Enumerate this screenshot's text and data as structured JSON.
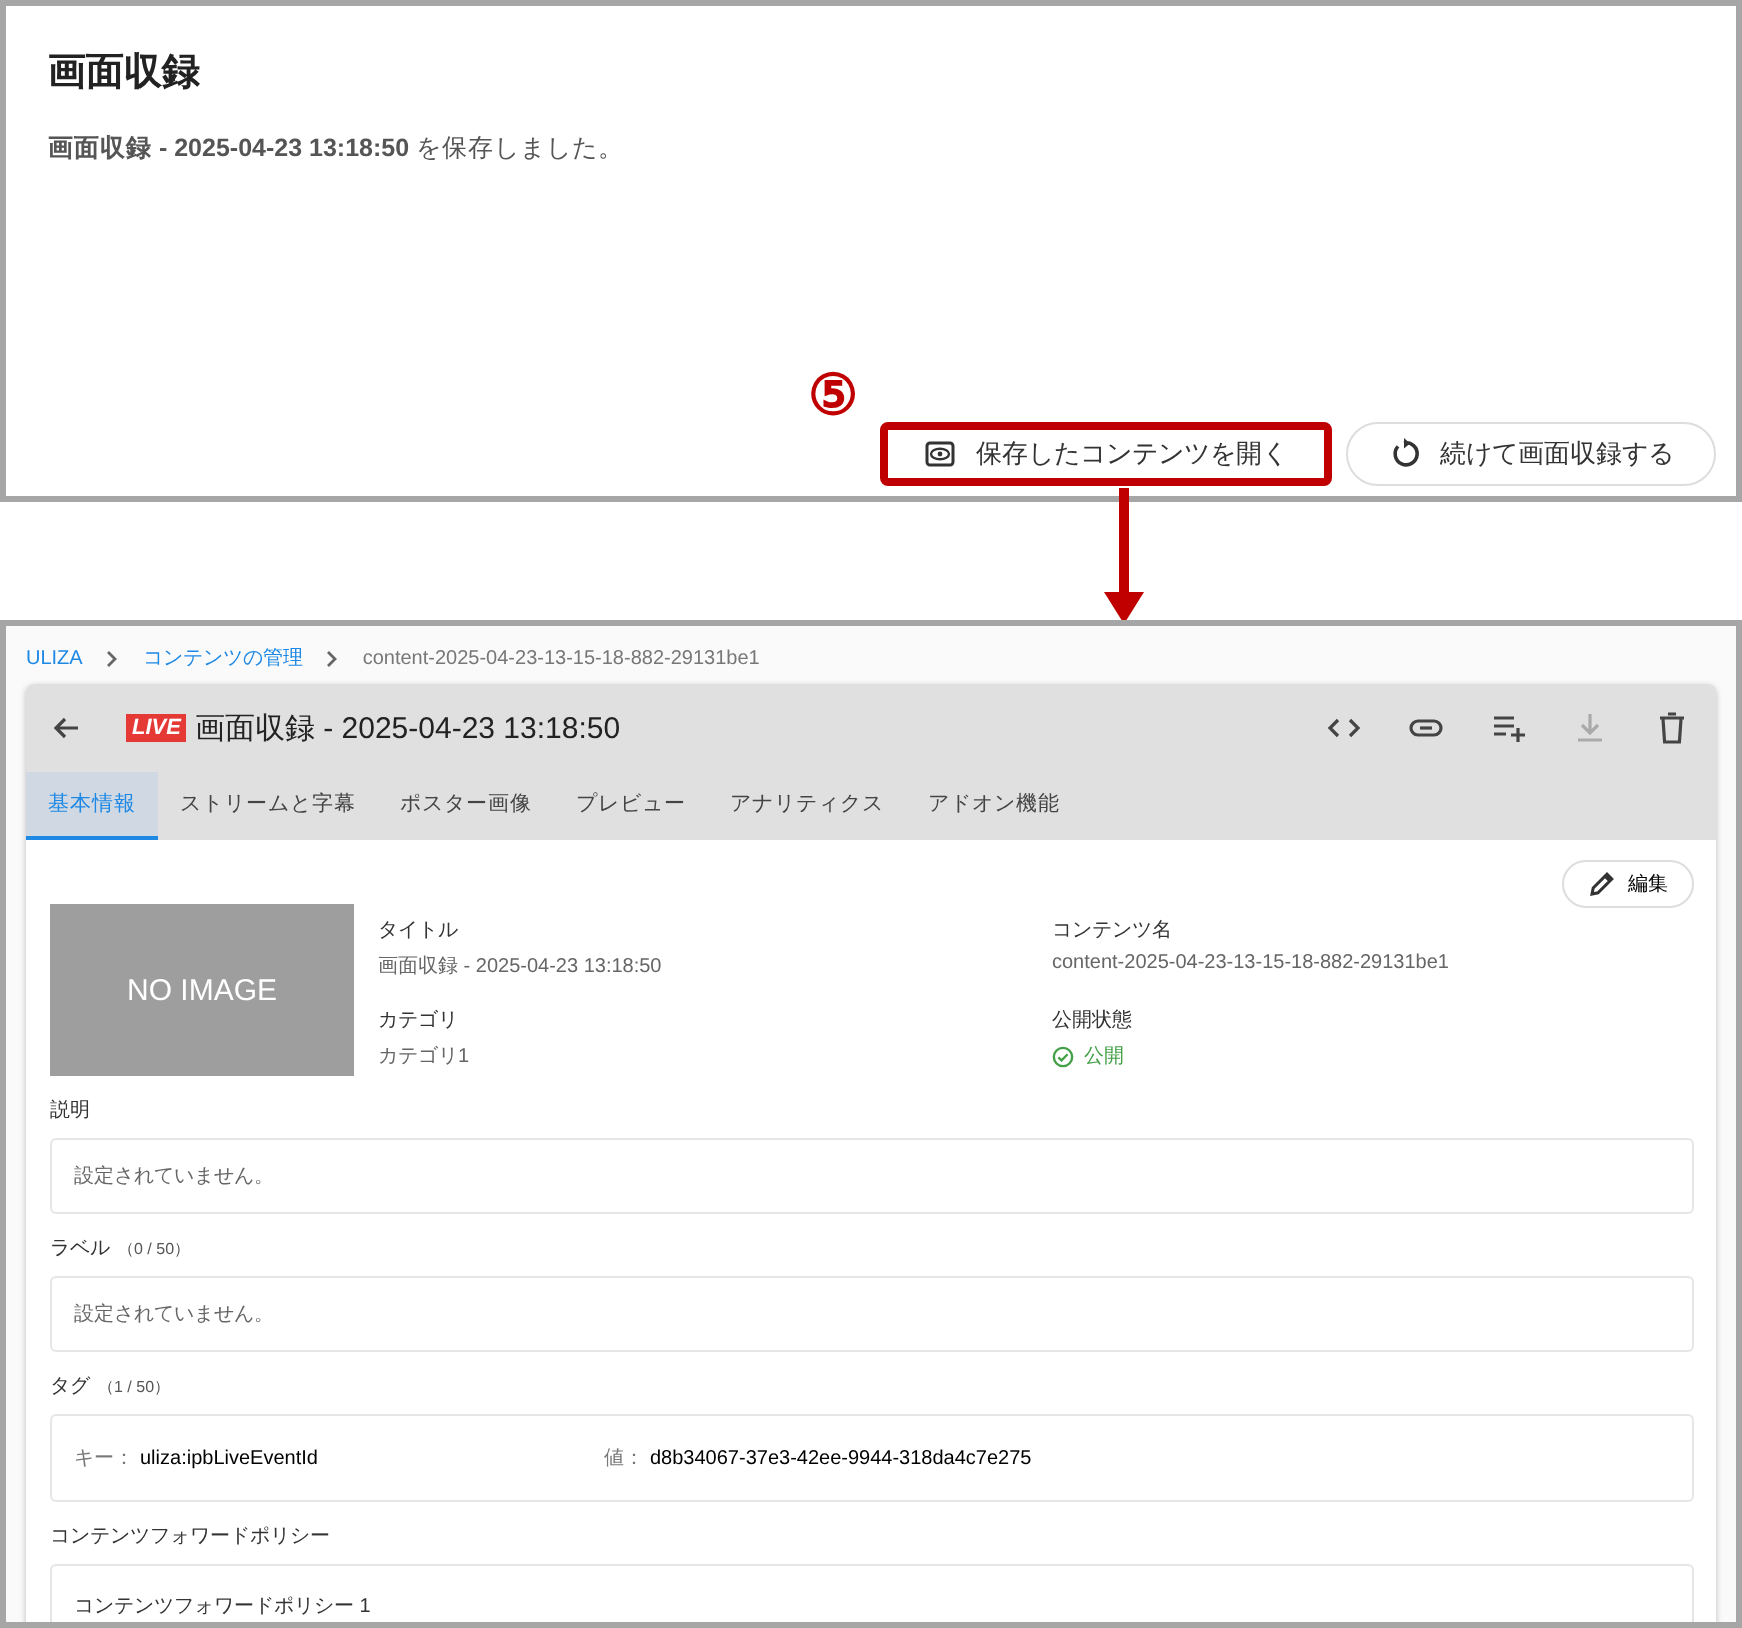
{
  "dialog": {
    "title": "画面収録",
    "message": "**画面収録 - 2025-04-23 13:18:50** を保存しました。",
    "buttons": [
      {
        "label": "保存したコンテンツを開く",
        "kind": "open",
        "highlighted": true
      },
      {
        "label": "続けて画面収録する",
        "kind": "restart",
        "highlighted": false
      }
    ]
  },
  "annotation": {
    "step": "⑤"
  },
  "breadcrumb": [
    {
      "label": "ULIZA",
      "link": true
    },
    {
      "label": "コンテンツの管理",
      "link": true
    },
    {
      "label": "content-2025-04-23-13-15-18-882-29131be1",
      "link": false
    }
  ],
  "header": {
    "badge": "LIVE",
    "title": "画面収録 - 2025-04-23 13:18:50",
    "actions": [
      {
        "kind": "code",
        "disabled": false
      },
      {
        "kind": "link",
        "disabled": false
      },
      {
        "kind": "playlist",
        "disabled": false
      },
      {
        "kind": "download",
        "disabled": true
      },
      {
        "kind": "delete",
        "disabled": false
      }
    ]
  },
  "tabs": [
    {
      "label": "基本情報",
      "selected": true
    },
    {
      "label": "ストリームと字幕",
      "selected": false
    },
    {
      "label": "ポスター画像",
      "selected": false
    },
    {
      "label": "プレビュー",
      "selected": false
    },
    {
      "label": "アナリティクス",
      "selected": false
    },
    {
      "label": "アドオン機能",
      "selected": false
    }
  ],
  "edit_button": "編集",
  "thumbnail": {
    "text": "NO IMAGE"
  },
  "fields": [
    {
      "label": "タイトル",
      "value": "画面収録 - 2025-04-23 13:18:50",
      "kind": "text"
    },
    {
      "label": "コンテンツ名",
      "value": "content-2025-04-23-13-15-18-882-29131be1",
      "kind": "text"
    },
    {
      "label": "カテゴリ",
      "value": "カテゴリ1",
      "kind": "text"
    },
    {
      "label": "公開状態",
      "value": "公開",
      "kind": "status"
    }
  ],
  "sections": [
    {
      "label": "説明",
      "kind": "text",
      "value": "設定されていません。"
    },
    {
      "label": "ラベル",
      "count": "（0 / 50）",
      "kind": "text",
      "value": "設定されていません。"
    },
    {
      "label": "タグ",
      "count": "（1 / 50）",
      "kind": "tag",
      "key_label": "キー：",
      "key": "uliza:ipbLiveEventId",
      "value_label": "値：",
      "value": "d8b34067-37e3-42ee-9944-318da4c7e275"
    },
    {
      "label": "コンテンツフォワードポリシー",
      "kind": "policy",
      "value": "コンテンツフォワードポリシー 1"
    }
  ]
}
